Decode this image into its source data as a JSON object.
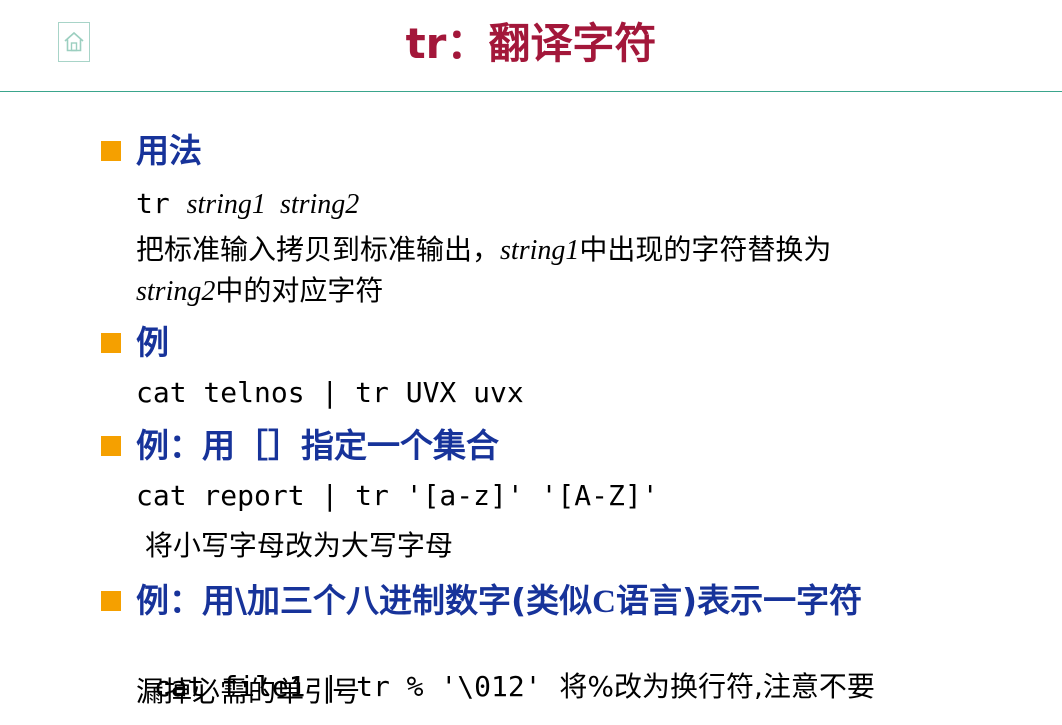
{
  "header": {
    "title": "tr：翻译字符",
    "home_icon": "home-icon"
  },
  "colors": {
    "title": "#a3173a",
    "heading": "#17339a",
    "bullet": "#f5a000",
    "rule": "#3aa58c"
  },
  "sections": [
    {
      "heading": "用法",
      "lines": [
        {
          "parts": [
            "tr ",
            "string1",
            "  ",
            "string2"
          ]
        },
        {
          "parts": [
            "把标准输入拷贝到标准输出，",
            "string1",
            "中出现的字符替换为"
          ]
        },
        {
          "parts": [
            "string2",
            "中的对应字符"
          ]
        }
      ]
    },
    {
      "heading": "例",
      "lines": [
        {
          "parts": [
            "cat telnos | tr UVX uvx"
          ]
        }
      ]
    },
    {
      "heading": "例：用［］指定一个集合",
      "lines": [
        {
          "parts": [
            "cat report | tr '[a-z]' '[A-Z]'"
          ]
        },
        {
          "parts": [
            " 将小写字母改为大写字母"
          ]
        }
      ]
    },
    {
      "heading_parts": [
        "例：用\\加三个八进制数字(类似",
        "C",
        "语言)表示一字符"
      ],
      "lines": [
        {
          "parts": [
            "cat file1 | tr % '\\012'",
            "  将%改为换行符,注意不要"
          ]
        },
        {
          "parts": [
            "漏掉必需的单引号"
          ]
        }
      ]
    }
  ]
}
